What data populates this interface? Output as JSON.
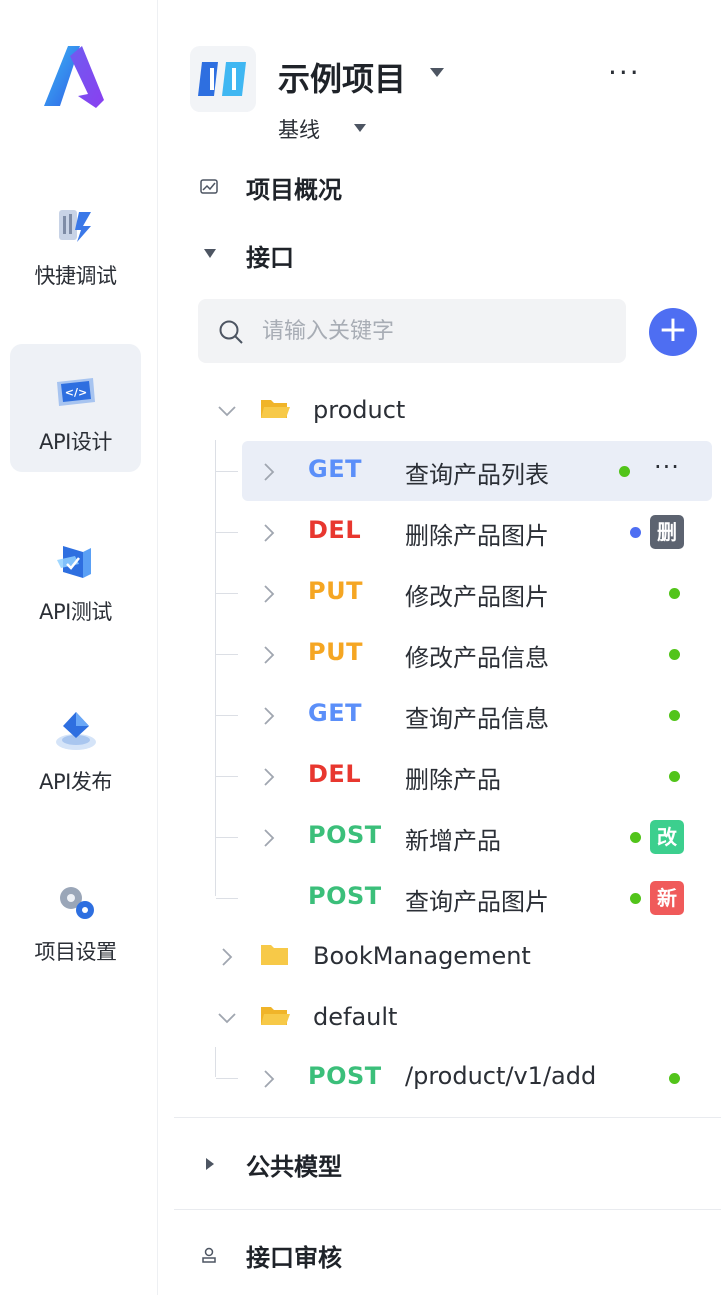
{
  "rail": {
    "items": [
      {
        "label": "快捷调试",
        "icon": "quick-debug-icon"
      },
      {
        "label": "API设计",
        "icon": "api-design-icon"
      },
      {
        "label": "API测试",
        "icon": "api-test-icon"
      },
      {
        "label": "API发布",
        "icon": "api-publish-icon"
      },
      {
        "label": "项目设置",
        "icon": "project-settings-icon"
      }
    ],
    "active": "API设计"
  },
  "project": {
    "name": "示例项目",
    "baseline": "基线",
    "more": "···"
  },
  "sections": {
    "overview": "项目概况",
    "apis": "接口",
    "models": "公共模型",
    "review": "接口审核"
  },
  "search": {
    "placeholder": "请输入关键字",
    "value": ""
  },
  "add_button": "+",
  "tree": {
    "folders": [
      {
        "name": "product",
        "expanded": true
      },
      {
        "name": "BookManagement",
        "expanded": false
      },
      {
        "name": "default",
        "expanded": true
      }
    ],
    "product_apis": [
      {
        "method": "GET",
        "name": "查询产品列表",
        "dot": "#52c41a",
        "badge": "",
        "selected": true
      },
      {
        "method": "DEL",
        "name": "删除产品图片",
        "dot": "#4e6ef2",
        "badge": "删",
        "badge_color": "#5c6370"
      },
      {
        "method": "PUT",
        "name": "修改产品图片",
        "dot": "#52c41a",
        "badge": ""
      },
      {
        "method": "PUT",
        "name": "修改产品信息",
        "dot": "#52c41a",
        "badge": ""
      },
      {
        "method": "GET",
        "name": "查询产品信息",
        "dot": "#52c41a",
        "badge": ""
      },
      {
        "method": "DEL",
        "name": "删除产品",
        "dot": "#52c41a",
        "badge": ""
      },
      {
        "method": "POST",
        "name": "新增产品",
        "dot": "#52c41a",
        "badge": "改",
        "badge_color": "#3ccf8e"
      },
      {
        "method": "POST",
        "name": "查询产品图片",
        "dot": "#52c41a",
        "badge": "新",
        "badge_color": "#f05a5a"
      }
    ],
    "default_apis": [
      {
        "method": "POST",
        "name": "/product/v1/add",
        "dot": "#52c41a",
        "badge": ""
      }
    ]
  },
  "row_more": "···",
  "colors": {
    "GET": "#5b8ff9",
    "DEL": "#e8372f",
    "PUT": "#f5a623",
    "POST": "#3bbf7a",
    "accent": "#4e6ef2",
    "folder": "#f7c948"
  }
}
